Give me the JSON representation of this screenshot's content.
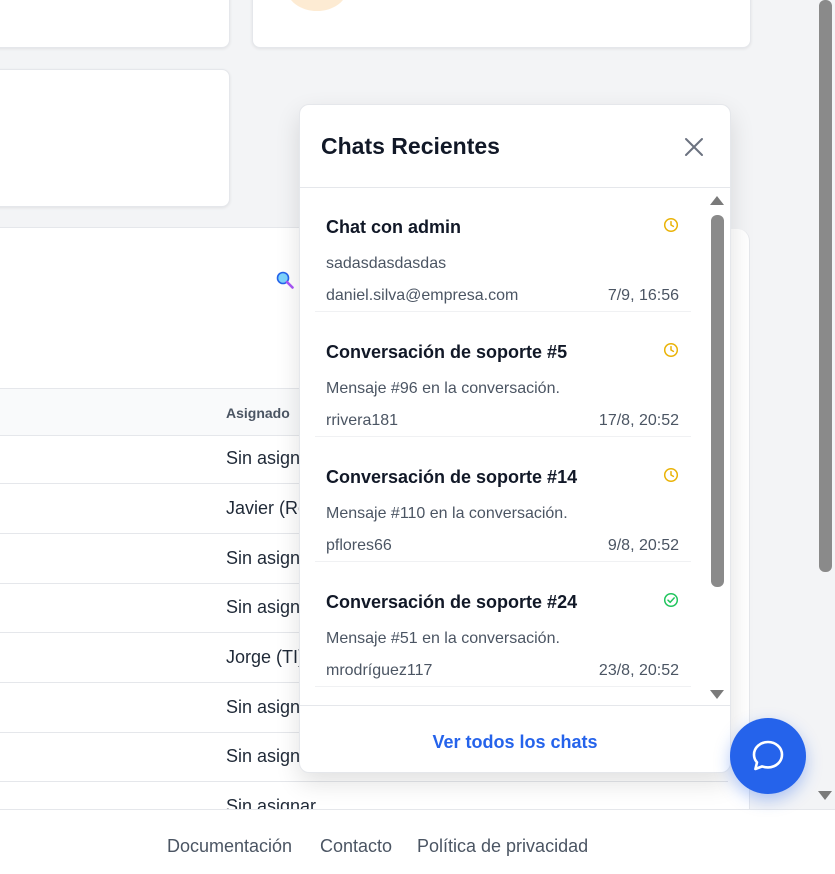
{
  "background": {
    "table": {
      "header_label": "Asignado",
      "rows": [
        "Sin asignar",
        "Javier (Re",
        "Sin asignar",
        "Sin asignar",
        "Jorge (TI)",
        "Sin asignar",
        "Sin asignar",
        "Sin asignar"
      ]
    }
  },
  "footer": {
    "links": [
      "Documentación",
      "Contacto",
      "Política de privacidad"
    ]
  },
  "chat_panel": {
    "title": "Chats Recientes",
    "close_icon": "close-icon",
    "view_all_label": "Ver todos los chats",
    "chats": [
      {
        "title": "Chat con admin",
        "message": "sadasdasdasdas",
        "user": "daniel.silva@empresa.com",
        "time": "7/9, 16:56",
        "status": "pending",
        "status_icon": "clock-icon"
      },
      {
        "title": "Conversación de soporte #5",
        "message": "Mensaje #96 en la conversación.",
        "user": "rrivera181",
        "time": "17/8, 20:52",
        "status": "pending",
        "status_icon": "clock-icon"
      },
      {
        "title": "Conversación de soporte #14",
        "message": "Mensaje #110 en la conversación.",
        "user": "pflores66",
        "time": "9/8, 20:52",
        "status": "pending",
        "status_icon": "clock-icon"
      },
      {
        "title": "Conversación de soporte #24",
        "message": "Mensaje #51 en la conversación.",
        "user": "mrodríguez117",
        "time": "23/8, 20:52",
        "status": "resolved",
        "status_icon": "check-circle-icon"
      }
    ]
  },
  "colors": {
    "accent": "#2563eb",
    "pending": "#eab308",
    "resolved": "#22c55e"
  },
  "fab": {
    "icon": "chat-bubble-icon"
  }
}
